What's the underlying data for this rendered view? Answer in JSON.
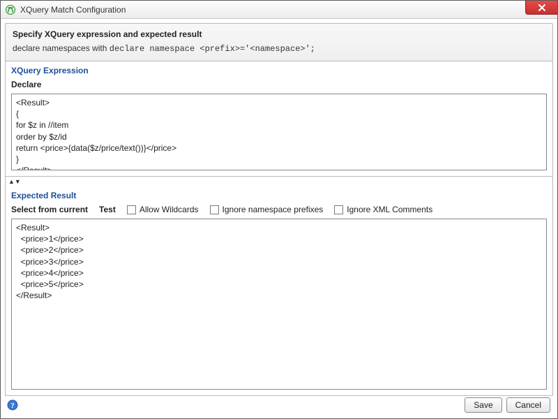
{
  "window": {
    "title": "XQuery Match Configuration"
  },
  "header": {
    "title": "Specify XQuery expression and expected result",
    "subtitle_prefix": "declare namespaces with ",
    "subtitle_code": "declare namespace <prefix>='<namespace>';"
  },
  "xquery": {
    "section_title": "XQuery Expression",
    "declare_label": "Declare",
    "expression": "<Result>\n{\nfor $z in //item\norder by $z/id\nreturn <price>{data($z/price/text())}</price>\n}\n</Result>"
  },
  "expected": {
    "section_title": "Expected Result",
    "select_from_current_label": "Select from current",
    "test_label": "Test",
    "allow_wildcards_label": "Allow Wildcards",
    "ignore_ns_label": "Ignore namespace prefixes",
    "ignore_comments_label": "Ignore XML Comments",
    "result": "<Result>\n  <price>1</price>\n  <price>2</price>\n  <price>3</price>\n  <price>4</price>\n  <price>5</price>\n</Result>"
  },
  "buttons": {
    "save": "Save",
    "cancel": "Cancel"
  }
}
